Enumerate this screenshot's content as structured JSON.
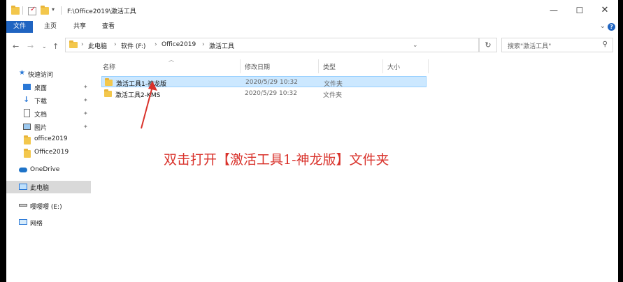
{
  "window": {
    "title_path": "F:\\Office2019\\激活工具",
    "controls": {
      "minimize": "—",
      "maximize": "☐",
      "close": "✕"
    }
  },
  "ribbon": {
    "tabs": [
      "文件",
      "主页",
      "共享",
      "查看"
    ]
  },
  "address_bar": {
    "crumbs": [
      "此电脑",
      "软件 (F:)",
      "Office2019",
      "激活工具"
    ],
    "separator": "›"
  },
  "search": {
    "placeholder": "搜索\"激活工具\""
  },
  "nav": {
    "quick_access": "快速访问",
    "items": [
      {
        "label": "桌面",
        "icon": "desktop-icon",
        "pinned": true
      },
      {
        "label": "下载",
        "icon": "download-icon",
        "pinned": true
      },
      {
        "label": "文档",
        "icon": "document-icon",
        "pinned": true
      },
      {
        "label": "图片",
        "icon": "picture-icon",
        "pinned": true
      },
      {
        "label": "office2019",
        "icon": "folder-icon",
        "pinned": false
      },
      {
        "label": "Office2019",
        "icon": "folder-icon",
        "pinned": false
      }
    ],
    "onedrive": "OneDrive",
    "this_pc": "此电脑",
    "drive_e": "嘤嘤嘤 (E:)",
    "network": "网络"
  },
  "columns": {
    "name": "名称",
    "modified": "修改日期",
    "type": "类型",
    "size": "大小"
  },
  "files": [
    {
      "name": "激活工具1-神龙版",
      "modified": "2020/5/29 10:32",
      "type": "文件夹",
      "selected": true
    },
    {
      "name": "激活工具2-KMS",
      "modified": "2020/5/29 10:32",
      "type": "文件夹",
      "selected": false
    }
  ],
  "annotation": {
    "text": "双击打开【激活工具1-神龙版】文件夹",
    "color": "#d9322b"
  },
  "colors": {
    "accent": "#1f64c1",
    "selection": "#cce8ff",
    "folder": "#f3c74c"
  }
}
